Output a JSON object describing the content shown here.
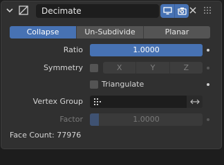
{
  "header": {
    "modifier_name": "Decimate",
    "icons": [
      "collapse-chevron-icon",
      "decimate-modifier-icon",
      "monitor-icon",
      "camera-icon",
      "dropdown-chevron-icon",
      "close-icon",
      "drag-grip-icon"
    ]
  },
  "tabs": [
    {
      "label": "Collapse",
      "active": true
    },
    {
      "label": "Un-Subdivide",
      "active": false
    },
    {
      "label": "Planar",
      "active": false
    }
  ],
  "ratio": {
    "label": "Ratio",
    "value": "1.0000"
  },
  "symmetry": {
    "label": "Symmetry",
    "checked": false,
    "axes": [
      "X",
      "Y",
      "Z"
    ]
  },
  "triangulate": {
    "label": "Triangulate",
    "checked": false
  },
  "vertex_group": {
    "label": "Vertex Group",
    "value": ""
  },
  "factor": {
    "label": "Factor",
    "value": "1.0000"
  },
  "face_count": {
    "text": "Face Count: 77976"
  },
  "colors": {
    "accent": "#4772b3",
    "panel": "#303030",
    "field": "#1d1d1d"
  }
}
